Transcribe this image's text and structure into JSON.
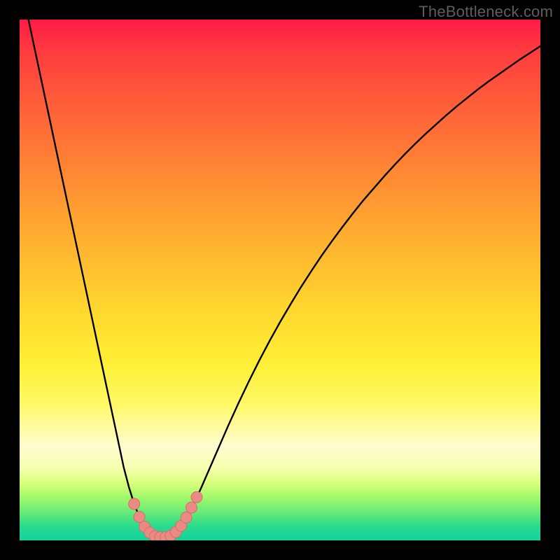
{
  "watermark": "TheBottleneck.com",
  "colors": {
    "frame": "#000000",
    "curve_stroke": "#000000",
    "marker_fill": "#e98a84",
    "marker_stroke": "#d46e68"
  },
  "chart_data": {
    "type": "line",
    "title": "",
    "xlabel": "",
    "ylabel": "",
    "xlim": [
      0,
      100
    ],
    "ylim": [
      0,
      100
    ],
    "grid": false,
    "legend": false,
    "x": [
      0,
      1,
      2,
      3,
      4,
      5,
      6,
      7,
      8,
      9,
      10,
      11,
      12,
      13,
      14,
      15,
      16,
      17,
      18,
      19,
      20,
      21,
      22,
      23,
      24,
      25,
      26,
      27,
      28,
      29,
      30,
      31,
      32,
      33,
      34,
      35,
      36,
      37,
      38,
      39,
      40,
      42,
      44,
      46,
      48,
      50,
      52,
      54,
      56,
      58,
      60,
      62,
      64,
      66,
      68,
      70,
      72,
      74,
      76,
      78,
      80,
      82,
      84,
      86,
      88,
      90,
      92,
      94,
      96,
      98,
      100
    ],
    "values": [
      108,
      103.3,
      98.6,
      93.9,
      89.2,
      84.5,
      79.8,
      75.1,
      70.4,
      65.7,
      61,
      56.3,
      51.6,
      46.9,
      42.2,
      37.5,
      32.8,
      28.1,
      23.4,
      18.7,
      14,
      10.2,
      7.0,
      4.5,
      2.6,
      1.2,
      0.4,
      0.1,
      0.2,
      0.6,
      1.4,
      2.6,
      4.2,
      6.1,
      8.2,
      10.4,
      12.7,
      15.0,
      17.3,
      19.6,
      21.9,
      26.3,
      30.5,
      34.5,
      38.3,
      41.9,
      45.3,
      48.6,
      51.7,
      54.7,
      57.5,
      60.2,
      62.8,
      65.3,
      67.6,
      69.9,
      72.1,
      74.2,
      76.2,
      78.1,
      79.9,
      81.7,
      83.4,
      85.0,
      86.6,
      88.1,
      89.5,
      90.9,
      92.3,
      93.6,
      94.9
    ],
    "markers": [
      {
        "x": 22,
        "y": 7.0
      },
      {
        "x": 23,
        "y": 4.5
      },
      {
        "x": 24,
        "y": 2.6
      },
      {
        "x": 25,
        "y": 1.5
      },
      {
        "x": 26,
        "y": 0.8
      },
      {
        "x": 27,
        "y": 0.6
      },
      {
        "x": 28,
        "y": 0.6
      },
      {
        "x": 29,
        "y": 0.9
      },
      {
        "x": 30,
        "y": 1.6
      },
      {
        "x": 31,
        "y": 2.8
      },
      {
        "x": 32,
        "y": 4.4
      },
      {
        "x": 33,
        "y": 6.3
      },
      {
        "x": 34,
        "y": 8.3
      }
    ]
  }
}
